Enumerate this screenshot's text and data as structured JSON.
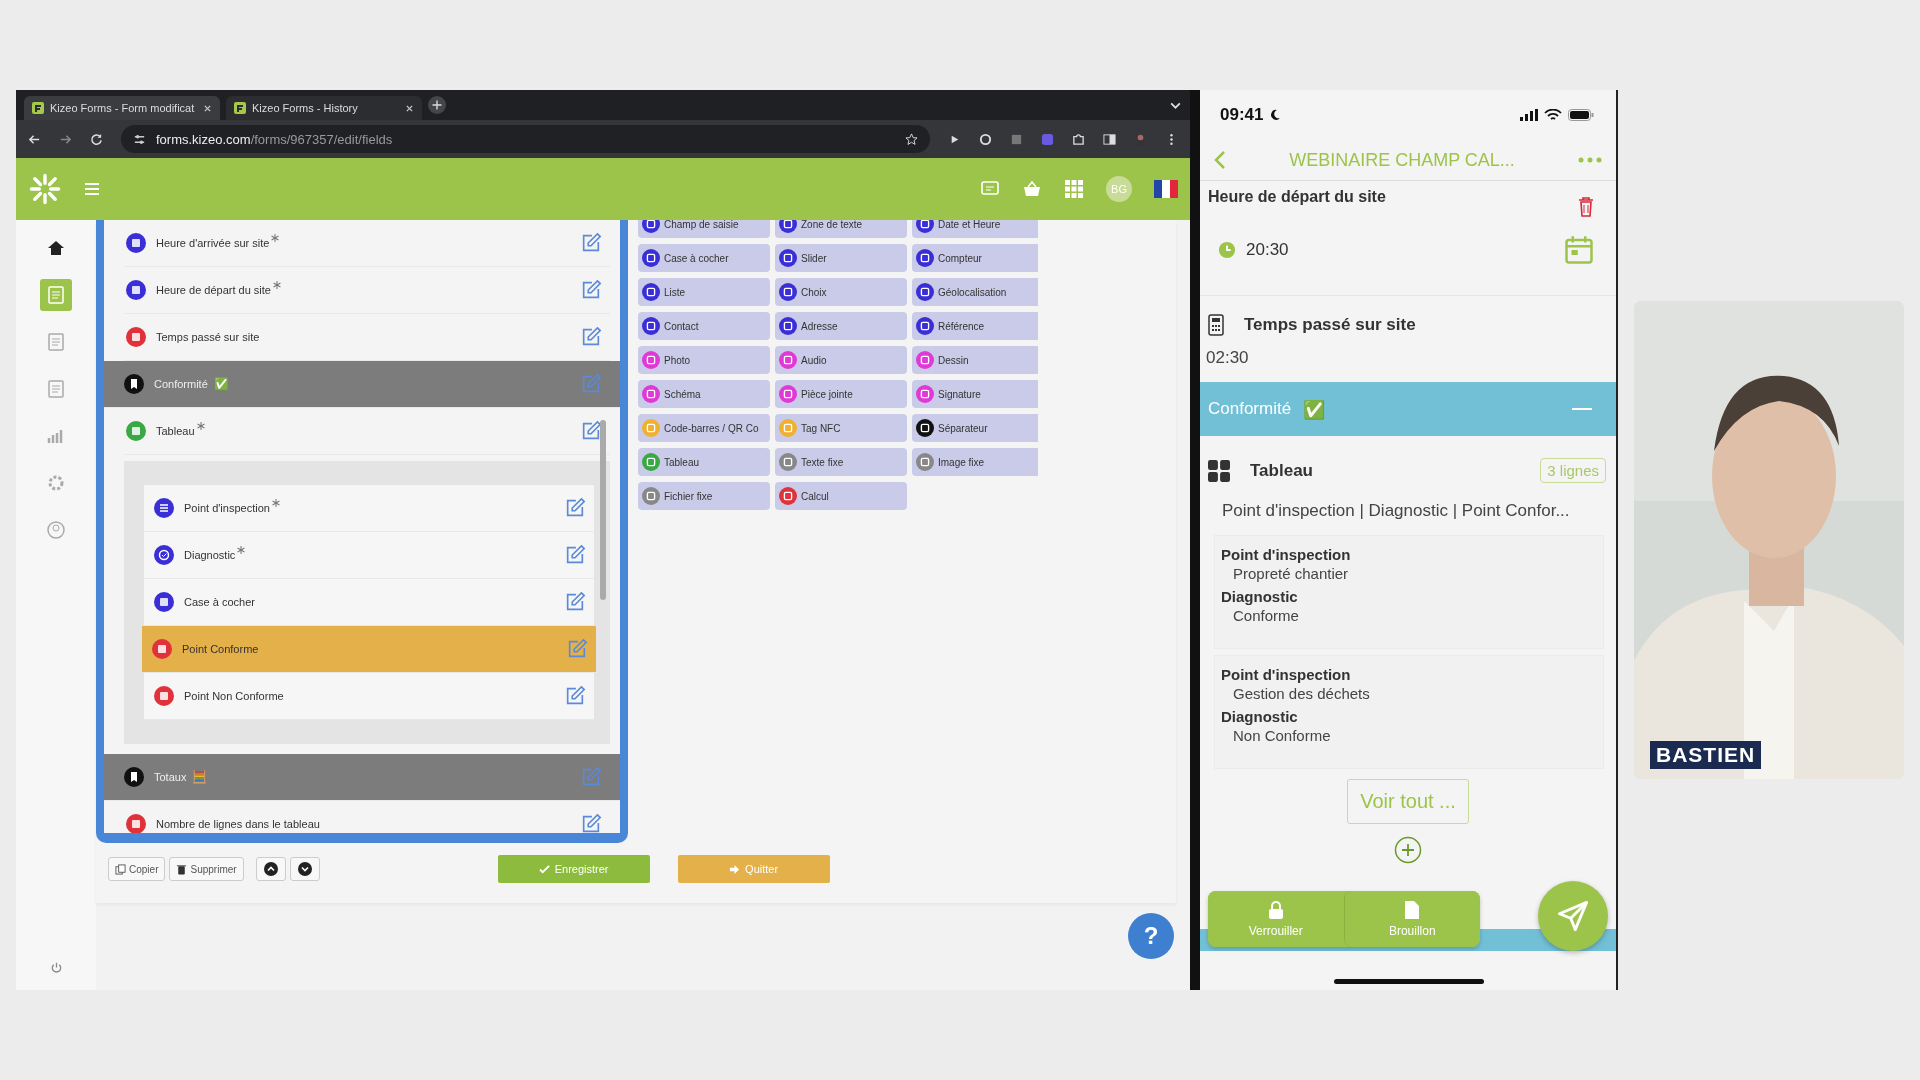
{
  "browser": {
    "tabs": [
      {
        "title": "Kizeo Forms - Form modificat",
        "selected": true
      },
      {
        "title": "Kizeo Forms - History",
        "selected": false
      }
    ],
    "url": {
      "host": "forms.kizeo.com",
      "path": "/forms/967357/edit/fields"
    },
    "avatar": "BG",
    "sidebar": [
      {
        "selected": false
      },
      {
        "selected": true
      },
      {
        "selected": false
      },
      {
        "selected": false
      },
      {
        "selected": false
      },
      {
        "selected": false
      },
      {
        "selected": false
      }
    ],
    "fields": [
      {
        "label": "Heure d'arrivée sur site",
        "kind": "date",
        "required": true,
        "selected": false
      },
      {
        "label": "Heure de départ du site",
        "kind": "date",
        "required": true,
        "selected": false
      },
      {
        "label": "Temps passé sur site",
        "kind": "calc",
        "required": false,
        "selected": false
      },
      {
        "label": "Conformité",
        "kind": "separator",
        "emoji": "✅",
        "required": false,
        "selected": false
      },
      {
        "label": "Tableau",
        "kind": "table",
        "required": true,
        "selected": false,
        "children": [
          {
            "label": "Point d'inspection",
            "kind": "list",
            "required": true,
            "selected": false
          },
          {
            "label": "Diagnostic",
            "kind": "choice",
            "required": true,
            "selected": false
          },
          {
            "label": "Case à cocher",
            "kind": "checkbox",
            "required": false,
            "selected": false
          },
          {
            "label": "Point Conforme",
            "kind": "calc",
            "required": false,
            "selected": true
          },
          {
            "label": "Point Non Conforme",
            "kind": "calc",
            "required": false,
            "selected": false
          }
        ]
      },
      {
        "label": "Totaux",
        "kind": "separator",
        "emoji": "🧮",
        "required": false,
        "selected": false
      },
      {
        "label": "Nombre de lignes dans le tableau",
        "kind": "calc",
        "required": false,
        "selected": false
      }
    ],
    "palette": [
      {
        "label": "Champ de saisie",
        "color": "#3a2fd6"
      },
      {
        "label": "Zone de texte",
        "color": "#3a2fd6"
      },
      {
        "label": "Date et Heure",
        "color": "#3a2fd6"
      },
      {
        "label": "Case à cocher",
        "color": "#3a2fd6"
      },
      {
        "label": "Slider",
        "color": "#3a2fd6"
      },
      {
        "label": "Compteur",
        "color": "#3a2fd6"
      },
      {
        "label": "Liste",
        "color": "#3a2fd6"
      },
      {
        "label": "Choix",
        "color": "#3a2fd6"
      },
      {
        "label": "Géolocalisation",
        "color": "#3a2fd6"
      },
      {
        "label": "Contact",
        "color": "#3a2fd6"
      },
      {
        "label": "Adresse",
        "color": "#3a2fd6"
      },
      {
        "label": "Référence",
        "color": "#3a2fd6"
      },
      {
        "label": "Photo",
        "color": "#e03ad6"
      },
      {
        "label": "Audio",
        "color": "#e03ad6"
      },
      {
        "label": "Dessin",
        "color": "#e03ad6"
      },
      {
        "label": "Schéma",
        "color": "#e03ad6"
      },
      {
        "label": "Pièce jointe",
        "color": "#e03ad6"
      },
      {
        "label": "Signature",
        "color": "#e03ad6"
      },
      {
        "label": "Code-barres / QR Co",
        "color": "#f0b030"
      },
      {
        "label": "Tag NFC",
        "color": "#f0b030"
      },
      {
        "label": "Séparateur",
        "color": "#111111"
      },
      {
        "label": "Tableau",
        "color": "#3aa845"
      },
      {
        "label": "Texte fixe",
        "color": "#888888"
      },
      {
        "label": "Image fixe",
        "color": "#888888"
      },
      {
        "label": "Fichier fixe",
        "color": "#888888"
      },
      {
        "label": "Calcul",
        "color": "#e0323a"
      }
    ],
    "tools": [
      "Copier",
      "Supprimer"
    ],
    "save": "Enregistrer",
    "quit": "Quitter",
    "help": "?"
  },
  "phone": {
    "time": "09:41",
    "title": "WEBINAIRE CHAMP CAL...",
    "cut_field": "Heure de départ du site",
    "time_value": "20:30",
    "calc_label": "Temps passé sur site",
    "calc_value": "02:30",
    "section": {
      "label": "Conformité",
      "emoji": "✅",
      "expanded": true
    },
    "table": {
      "label": "Tableau",
      "badge": "3 lignes",
      "columns": "Point d'inspection | Diagnostic | Point Confor...",
      "rows": [
        [
          {
            "label": "Point d'inspection",
            "value": "Propreté chantier"
          },
          {
            "label": "Diagnostic",
            "value": "Conforme"
          }
        ],
        [
          {
            "label": "Point d'inspection",
            "value": "Gestion des déchets"
          },
          {
            "label": "Diagnostic",
            "value": "Non Conforme"
          }
        ]
      ],
      "more": "Voir tout ..."
    },
    "actions": [
      "Verrouiller",
      "Brouillon"
    ]
  },
  "webcam": {
    "kind": "picture",
    "name": "BASTIEN"
  }
}
